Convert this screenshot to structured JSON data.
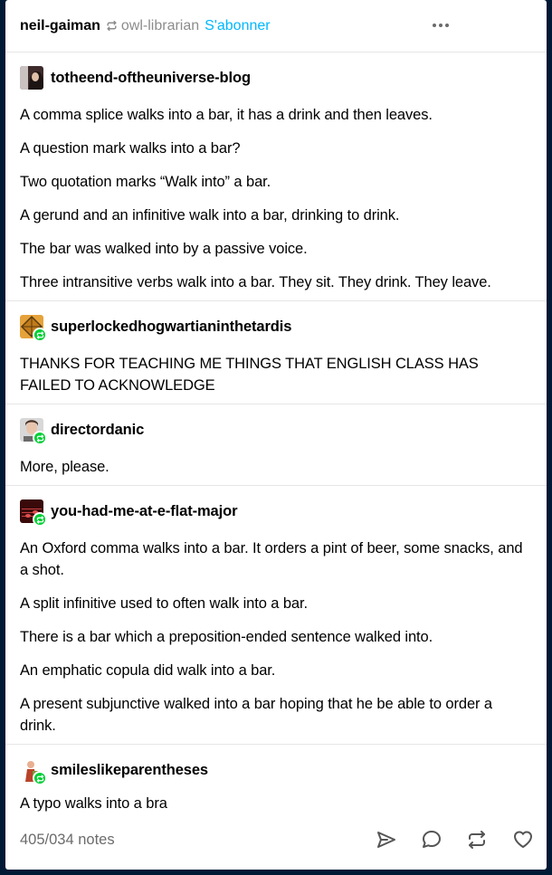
{
  "header": {
    "poster": "neil-gaiman",
    "source": "owl-librarian",
    "follow_label": "S'abonner"
  },
  "thread": [
    {
      "author": "totheend-oftheuniverse-blog",
      "paragraphs": [
        "A comma splice walks into a bar, it has a drink and then leaves.",
        "A question mark walks into a bar?",
        "Two quotation marks “Walk into” a bar.",
        "A gerund and an infinitive walk into a bar, drinking to drink.",
        "The bar was walked into by a passive voice.",
        "Three intransitive verbs walk into a bar. They sit. They drink. They leave."
      ]
    },
    {
      "author": "superlockedhogwartianinthetardis",
      "paragraphs": [
        "THANKS FOR TEACHING ME THINGS THAT ENGLISH CLASS HAS FAILED TO ACKNOWLEDGE"
      ]
    },
    {
      "author": "directordanic",
      "paragraphs": [
        "More, please."
      ]
    },
    {
      "author": "you-had-me-at-e-flat-major",
      "paragraphs": [
        "An Oxford comma walks into a bar. It orders a pint of beer, some snacks, and a shot.",
        "A split infinitive used to often walk into a bar.",
        "There is a bar which a preposition-ended sentence walked into.",
        "An emphatic copula did walk into a bar.",
        "A present subjunctive walked into a bar hoping that he be able to order a drink."
      ]
    },
    {
      "author": "smileslikeparentheses",
      "paragraphs": [
        "A typo walks into a bra"
      ]
    }
  ],
  "footer": {
    "notes": "405/034 notes",
    "actions": [
      "share-icon",
      "reply-icon",
      "reblog-icon",
      "like-icon"
    ]
  },
  "colors": {
    "background": "#001935",
    "accent": "#00b8ff",
    "reblog_badge": "#00cf35",
    "muted": "#6b6b6b"
  }
}
